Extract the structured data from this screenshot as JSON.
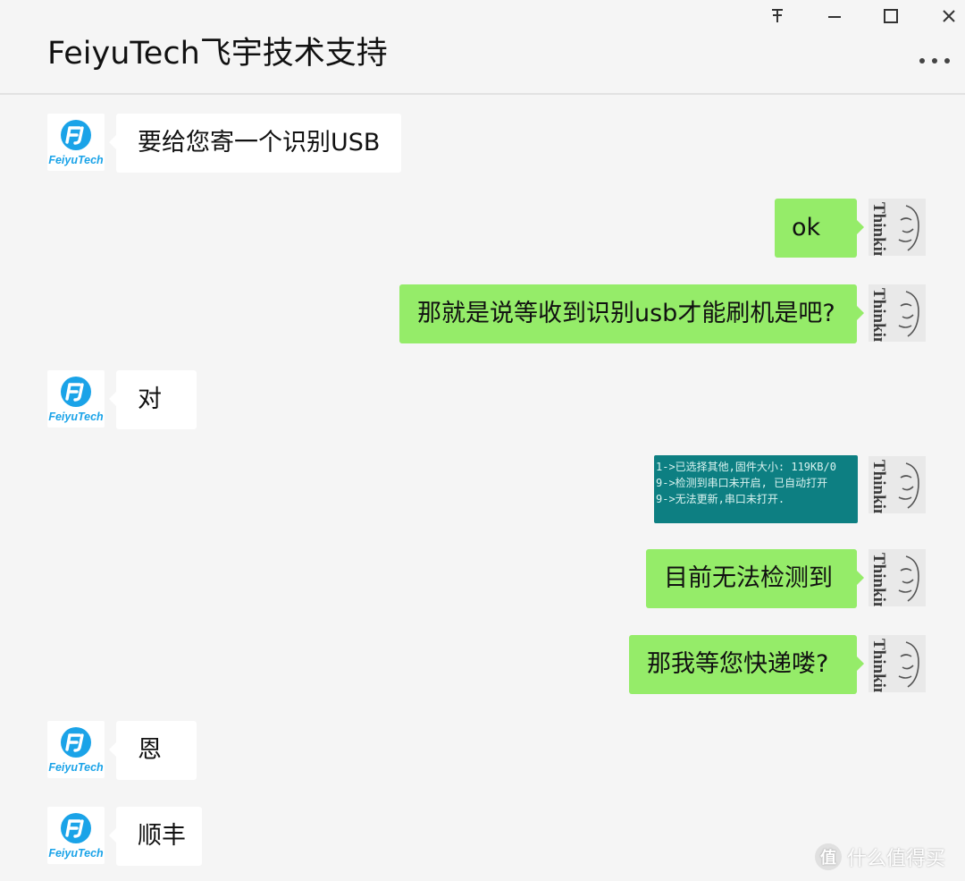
{
  "window": {
    "title": "FeiyuTech飞宇技术支持",
    "pin_glyph": "ᅎ",
    "minimize_glyph": "—",
    "maximize_glyph": "☐",
    "close_glyph": "✕",
    "more_glyph": "•••"
  },
  "brand": {
    "name": "FeiyuTech",
    "mark": "F",
    "color": "#1aa3e8"
  },
  "user_avatar": {
    "text": "Thinking"
  },
  "messages": [
    {
      "side": "in",
      "text": "要给您寄一个识别USB"
    },
    {
      "side": "out",
      "text": "ok"
    },
    {
      "side": "out",
      "text": "那就是说等收到识别usb才能刷机是吧?"
    },
    {
      "side": "in",
      "text": "对"
    },
    {
      "side": "out",
      "type": "image",
      "lines": [
        "1->已选择其他,固件大小: 119KB/0",
        "9->检测到串口未开启, 已自动打开",
        "9->无法更新,串口未打开."
      ]
    },
    {
      "side": "out",
      "text": "目前无法检测到"
    },
    {
      "side": "out",
      "text": "那我等您快递喽?"
    },
    {
      "side": "in",
      "text": "恩"
    },
    {
      "side": "in",
      "text": "顺丰"
    }
  ],
  "watermark": {
    "logo": "值",
    "text": "什么值得买"
  },
  "colors": {
    "out_bubble": "#95ec69",
    "in_bubble": "#ffffff",
    "background": "#f5f5f5"
  }
}
